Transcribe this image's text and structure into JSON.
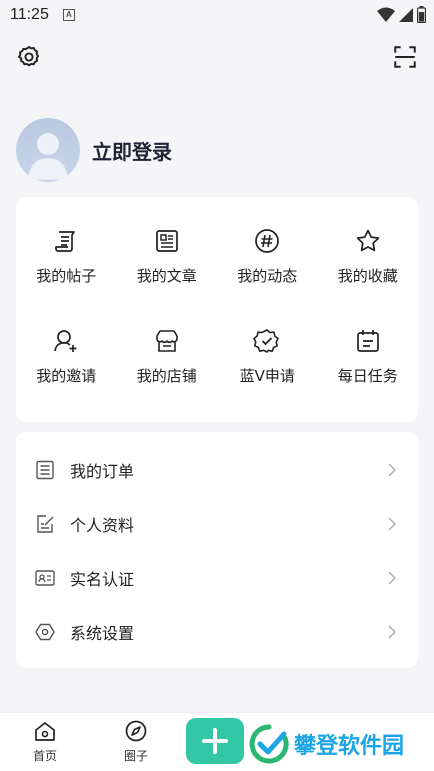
{
  "status_bar": {
    "time": "11:25",
    "notification_icon": "A"
  },
  "top_bar": {
    "left_icon": "gear-icon",
    "right_icon": "scan-icon"
  },
  "profile": {
    "login_label": "立即登录"
  },
  "grid": {
    "row1": [
      {
        "label": "我的帖子",
        "icon": "post-icon"
      },
      {
        "label": "我的文章",
        "icon": "article-icon"
      },
      {
        "label": "我的动态",
        "icon": "hashtag-icon"
      },
      {
        "label": "我的收藏",
        "icon": "star-icon"
      }
    ],
    "row2": [
      {
        "label": "我的邀请",
        "icon": "invite-user-icon"
      },
      {
        "label": "我的店铺",
        "icon": "store-icon"
      },
      {
        "label": "蓝V申请",
        "icon": "verified-badge-icon"
      },
      {
        "label": "每日任务",
        "icon": "calendar-task-icon"
      }
    ]
  },
  "menu": [
    {
      "label": "我的订单",
      "icon": "order-list-icon"
    },
    {
      "label": "个人资料",
      "icon": "edit-profile-icon"
    },
    {
      "label": "实名认证",
      "icon": "id-card-icon"
    },
    {
      "label": "系统设置",
      "icon": "hexagon-settings-icon"
    }
  ],
  "tabs": [
    {
      "label": "首页",
      "icon": "home-icon"
    },
    {
      "label": "圈子",
      "icon": "compass-icon"
    }
  ],
  "fab": {
    "icon": "plus-icon"
  },
  "watermark": {
    "text": "攀登软件园"
  },
  "colors": {
    "accent": "#33c7a5",
    "watermark": "#1aa5e6",
    "background": "#f5f5f7"
  }
}
